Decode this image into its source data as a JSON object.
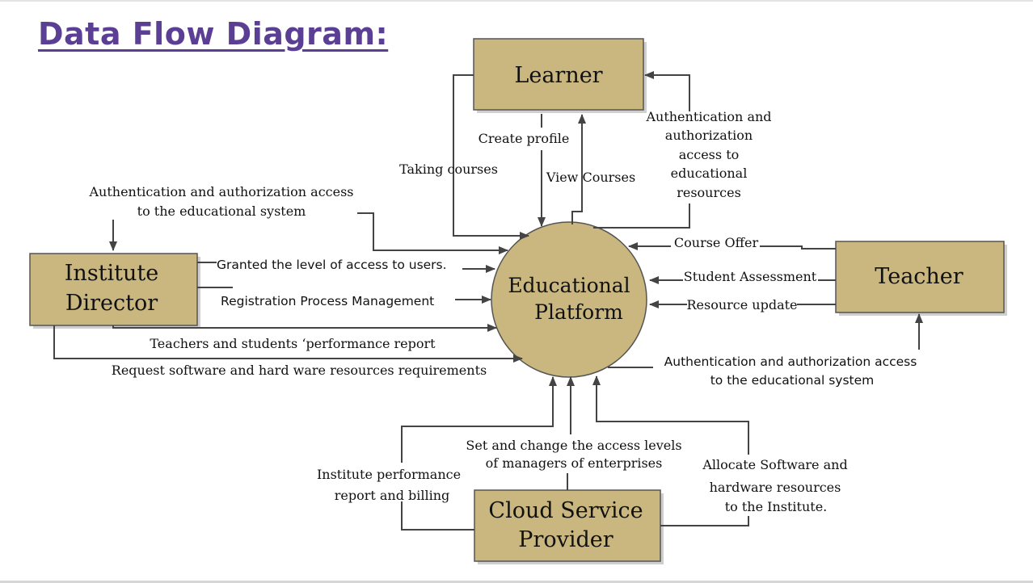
{
  "title": "Data Flow Diagram:",
  "colors": {
    "title": "#5b3f94",
    "entity_fill": "#c9b77f",
    "entity_border": "#555555",
    "process_fill": "#c9b77f",
    "line": "#444444"
  },
  "process": {
    "line1": "Educational",
    "line2": "Platform"
  },
  "entities": {
    "learner": "Learner",
    "director": {
      "line1": "Institute",
      "line2": "Director"
    },
    "teacher": "Teacher",
    "cloud": {
      "line1": "Cloud Service",
      "line2": "Provider"
    }
  },
  "flows": {
    "create_profile": "Create profile",
    "taking_courses": "Taking courses",
    "view_courses": "View Courses",
    "learner_auth": [
      "Authentication and",
      "authorization",
      "access  to",
      "educational",
      "resources"
    ],
    "director_auth": [
      "Authentication and authorization access",
      "to the educational  system"
    ],
    "granted_access": "Granted  the level of access to users.",
    "registration": "Registration  Process  Management",
    "performance_report": "Teachers and students ‘performance  report",
    "request_resources": "Request software and hard ware resources requirements",
    "course_offer": "Course Offer",
    "student_assessment": "Student Assessment",
    "resource_update": "Resource update",
    "teacher_auth": [
      "Authentication  and authorization  access",
      "to the educational  system"
    ],
    "set_access": [
      "Set and change  the access  levels",
      "of managers  of enterprises"
    ],
    "institute_billing": [
      "Institute performance",
      "report and billing"
    ],
    "allocate": [
      "Allocate Software and",
      "hardware resources",
      "to the Institute."
    ]
  }
}
